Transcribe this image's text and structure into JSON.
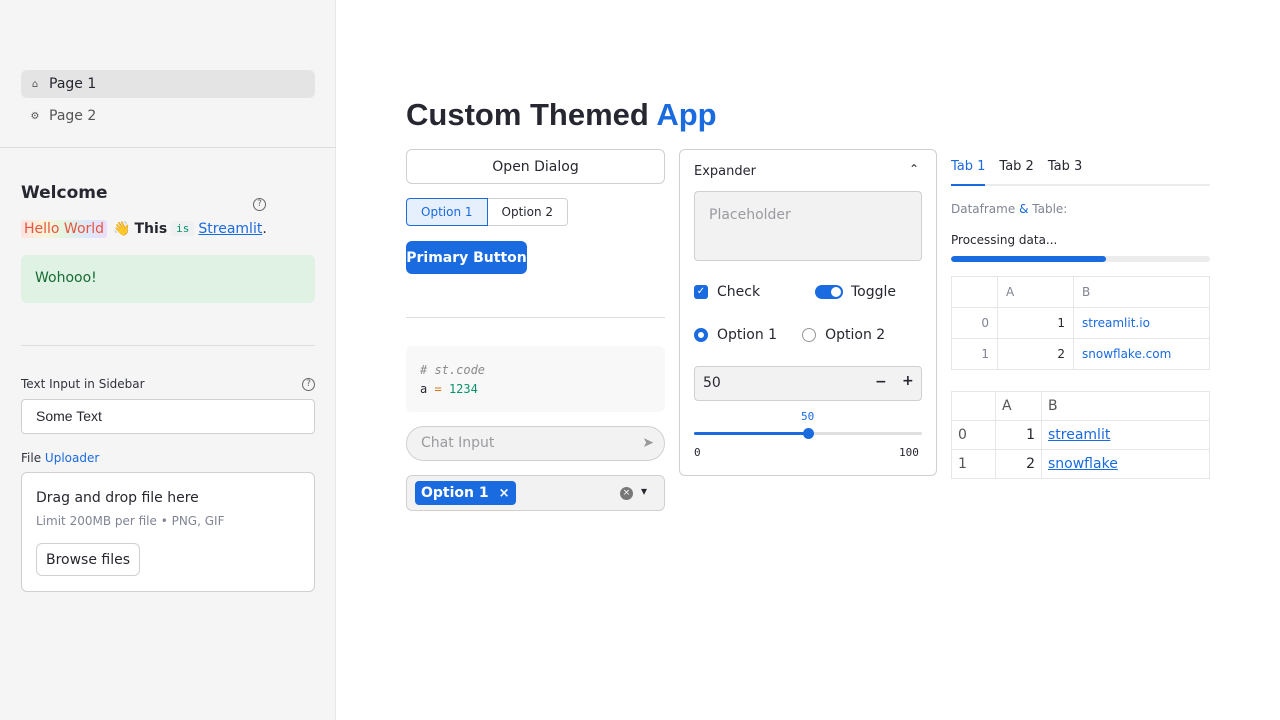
{
  "sidebar": {
    "nav": [
      {
        "label": "Page 1",
        "icon": "home-icon",
        "glyph": "⌂"
      },
      {
        "label": "Page 2",
        "icon": "gear-icon",
        "glyph": "⚙"
      }
    ],
    "welcome": "Welcome",
    "hello": {
      "rainbow_text": "Hello World",
      "emoji": "👋",
      "bold": "This",
      "code": "is",
      "link": "Streamlit",
      "period": "."
    },
    "success_text": "Wohooo!",
    "text_input": {
      "label": "Text Input in Sidebar",
      "value": "Some Text"
    },
    "file": {
      "label_prefix": "File",
      "label_link": "Uploader",
      "drag_text": "Drag and drop file here",
      "limit_text": "Limit 200MB per file • PNG, GIF",
      "browse_label": "Browse files"
    }
  },
  "main": {
    "title_part1": "Custom Themed",
    "title_part2": "App",
    "open_dialog": "Open Dialog",
    "segmented": [
      "Option 1",
      "Option 2"
    ],
    "primary_button": "Primary Button",
    "code": {
      "comment": "# st.code",
      "var": "a",
      "op": "=",
      "value": "1234"
    },
    "chat_placeholder": "Chat Input",
    "multiselect_chip": "Option 1",
    "expander": {
      "title": "Expander",
      "textarea_placeholder": "Placeholder",
      "checkbox_label": "Check",
      "toggle_label": "Toggle",
      "radio": [
        "Option 1",
        "Option 2"
      ],
      "number_value": "50",
      "slider": {
        "value": 50,
        "min": 0,
        "max": 100,
        "value_label": "50",
        "min_label": "0",
        "max_label": "100"
      }
    },
    "tabs": [
      "Tab 1",
      "Tab 2",
      "Tab 3"
    ],
    "df_label_a": "Dataframe",
    "df_label_amp": "&",
    "df_label_b": "Table:",
    "processing": "Processing data...",
    "progress": 0.6,
    "dataframe": {
      "columns": [
        "A",
        "B"
      ],
      "rows": [
        [
          "0",
          "1",
          "streamlit.io"
        ],
        [
          "1",
          "2",
          "snowflake.com"
        ]
      ]
    },
    "table": {
      "columns": [
        "A",
        "B"
      ],
      "rows": [
        [
          "0",
          "1",
          "streamlit"
        ],
        [
          "1",
          "2",
          "snowflake"
        ]
      ]
    }
  },
  "colors": {
    "accent": "#1a6ae0",
    "success_bg": "#dff2e3",
    "sidebar_bg": "#f5f5f5"
  }
}
